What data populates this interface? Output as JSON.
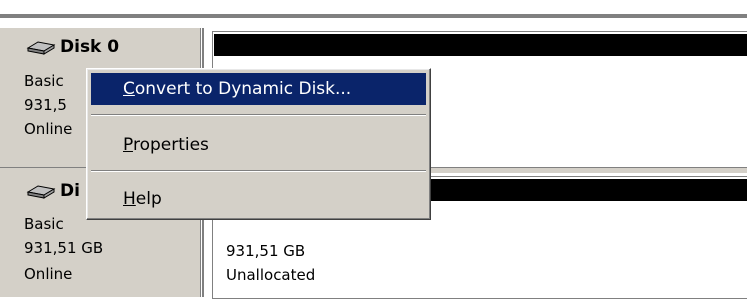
{
  "disks": [
    {
      "name": "Disk 0",
      "type": "Basic",
      "size": "931,5",
      "status": "Online"
    },
    {
      "name": "Di",
      "type": "Basic",
      "size": "931,51 GB",
      "status": "Online"
    }
  ],
  "partition1": {
    "size": "931,51 GB",
    "state": "Unallocated"
  },
  "context_menu": {
    "items": [
      {
        "accel": "C",
        "rest": "onvert to Dynamic Disk...",
        "highlighted": true
      },
      {
        "accel": "P",
        "rest": "roperties",
        "highlighted": false
      },
      {
        "accel": "H",
        "rest": "elp",
        "highlighted": false
      }
    ]
  },
  "colors": {
    "highlight": "#0a246a",
    "face": "#d4d0c8"
  }
}
